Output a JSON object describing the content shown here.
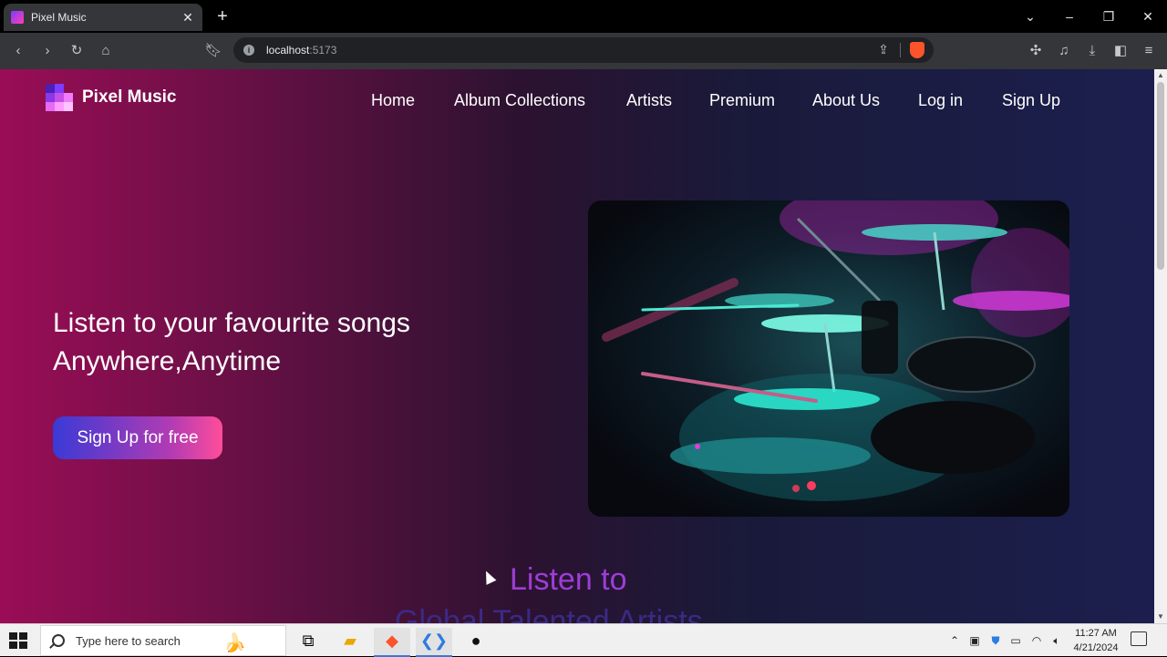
{
  "browser": {
    "tab_title": "Pixel Music",
    "url_host": "localhost",
    "url_port": ":5173"
  },
  "site": {
    "logo_text": "Pixel Music",
    "nav": [
      "Home",
      "Album Collections",
      "Artists",
      "Premium",
      "About Us",
      "Log in",
      "Sign Up"
    ],
    "hero": {
      "line1": "Listen to your favourite songs",
      "line2": "Anywhere,Anytime",
      "cta": "Sign Up for free"
    },
    "section": {
      "line1": "Listen to",
      "line2": "Global Talented Artists"
    }
  },
  "taskbar": {
    "search_placeholder": "Type here to search",
    "time": "11:27 AM",
    "date": "4/21/2024"
  },
  "colors": {
    "accent_gradient_start": "#3a3ad6",
    "accent_gradient_end": "#ff4d9a",
    "page_left": "#9a0d56",
    "page_right": "#1c1f4e"
  }
}
